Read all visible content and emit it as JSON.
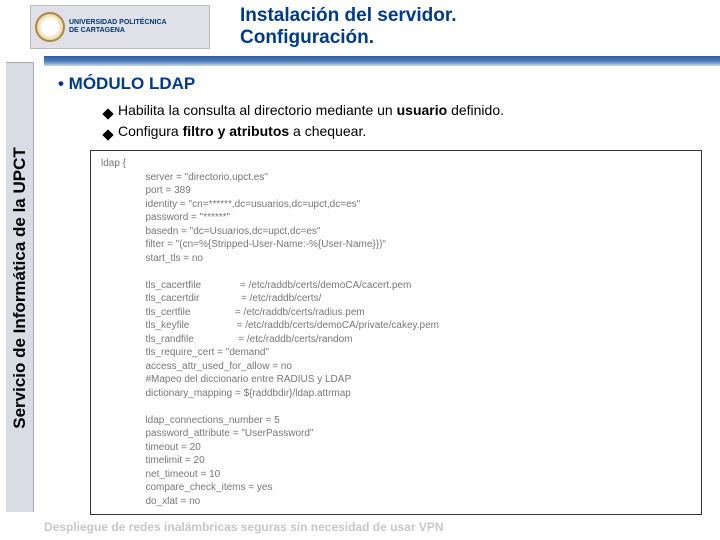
{
  "logo": {
    "line1": "UNIVERSIDAD POLITÉCNICA",
    "line2": "DE CARTAGENA"
  },
  "title": {
    "line1": "Instalación del servidor.",
    "line2": "Configuración."
  },
  "sidebar": "Servicio de Informática de la UPCT",
  "section": "• MÓDULO LDAP",
  "bullet1_pre": "Habilita la consulta al directorio mediante un ",
  "bullet1_bold": "usuario",
  "bullet1_post": " definido.",
  "bullet2_pre": "Configura ",
  "bullet2_bold": "filtro y atributos",
  "bullet2_post": " a chequear.",
  "code": "ldap {\n                server = \"directorio.upct.es\"\n                port = 389\n                identity = \"cn=******,dc=usuarios,dc=upct,dc=es\"\n                password = \"******\"\n                basedn = \"dc=Usuarios,dc=upct,dc=es\"\n                filter = \"(cn=%{Stripped-User-Name:-%{User-Name}})\"\n                start_tls = no\n\n                tls_cacertfile              = /etc/raddb/certs/demoCA/cacert.pem\n                tls_cacertdir               = /etc/raddb/certs/\n                tls_certfile                = /etc/raddb/certs/radius.pem\n                tls_keyfile                 = /etc/raddb/certs/demoCA/private/cakey.pem\n                tls_randfile                = /etc/raddb/certs/random\n                tls_require_cert = \"demand\"\n                access_attr_used_for_allow = no\n                #Mapeo del diccionario entre RADIUS y LDAP\n                dictionary_mapping = ${raddbdir}/ldap.attrmap\n\n                ldap_connections_number = 5\n                password_attribute = \"UserPassword\"\n                timeout = 20\n                timelimit = 20\n                net_timeout = 10\n                compare_check_items = yes\n                do_xlat = no",
  "footer": "Despliegue de redes inalámbricas seguras sin necesidad de usar VPN"
}
